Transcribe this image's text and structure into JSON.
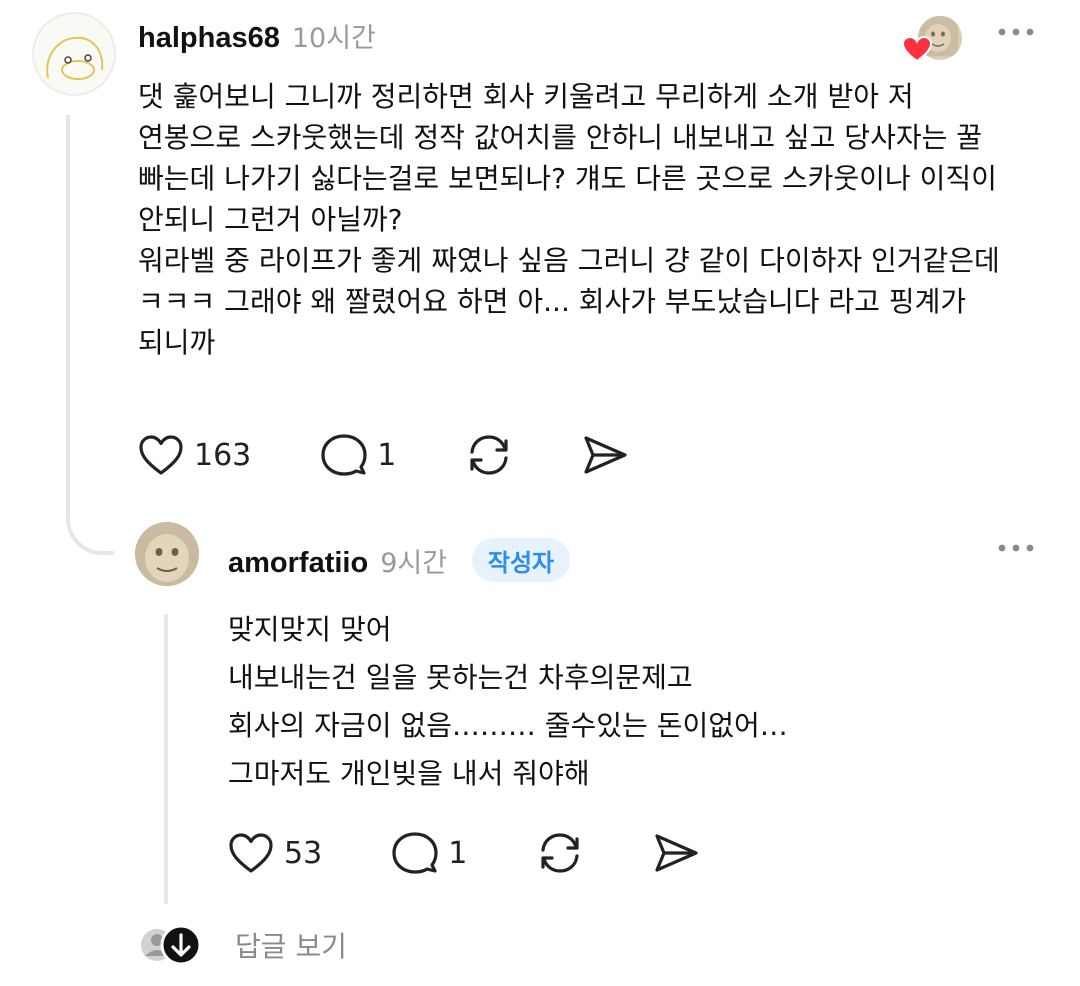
{
  "comment": {
    "username": "halphas68",
    "time": "10시간",
    "body": "댓 훑어보니 그니까 정리하면 회사 키울려고 무리하게 소개 받아 저\n연봉으로 스카웃했는데 정작 값어치를 안하니 내보내고 싶고 당사자는 꿀\n빠는데 나가기 싫다는걸로 보면되나? 걔도 다른 곳으로 스카웃이나 이직이\n안되니 그런거 아닐까?\n워라벨 중 라이프가 좋게 짜였나 싶음 그러니 걍 같이 다이하자 인거같은데\nㅋㅋㅋ 그래야 왜 짤렸어요 하면 아... 회사가 부도났습니다 라고 핑계가\n되니까",
    "likes": "163",
    "replies": "1"
  },
  "reply": {
    "username": "amorfatiio",
    "time": "9시간",
    "author_badge": "작성자",
    "body": "맞지맞지 맞어\n내보내는건 일을 못하는건 차후의문제고\n회사의 자금이 없음……… 줄수있는 돈이없어…\n그마저도 개인빚을 내서 줘야해",
    "likes": "53",
    "replies": "1"
  },
  "view_replies_label": "답글 보기",
  "colors": {
    "heart": "#ff3040",
    "badge_bg": "#e6f2fd",
    "badge_text": "#2d8cf0",
    "thread_line": "#e6e6e6"
  }
}
